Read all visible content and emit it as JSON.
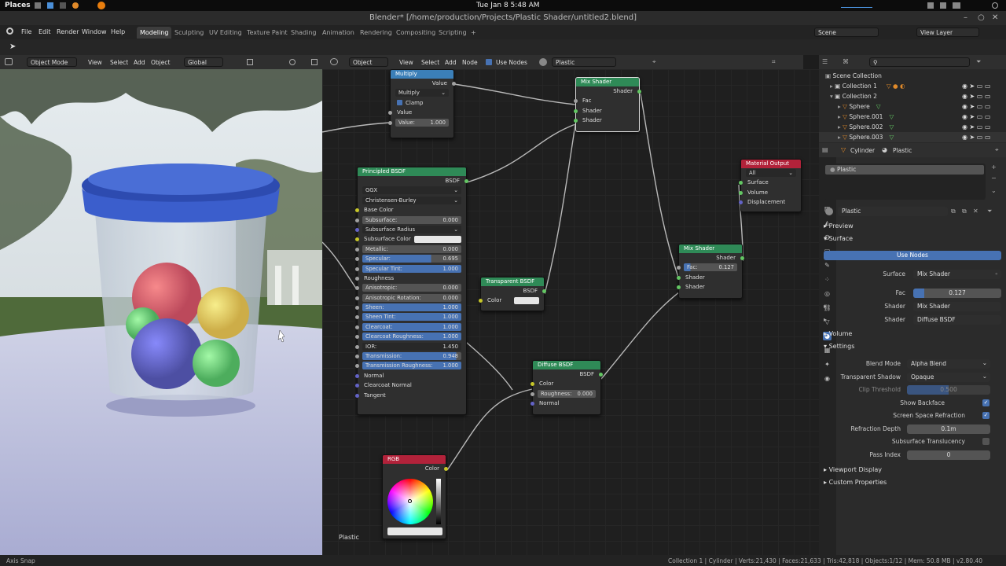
{
  "os_bar": {
    "places": "Places",
    "clock": "Tue Jan 8  5:48 AM"
  },
  "window_title": "Blender* [/home/production/Projects/Plastic Shader/untitled2.blend]",
  "menu": [
    "File",
    "Edit",
    "Render",
    "Window",
    "Help"
  ],
  "workspaces": [
    "Modeling",
    "Sculpting",
    "UV Editing",
    "Texture Paint",
    "Shading",
    "Animation",
    "Rendering",
    "Compositing",
    "Scripting"
  ],
  "active_workspace": "Modeling",
  "scene": "Scene",
  "view_layer": "View Layer",
  "viewport_header": {
    "mode": "Object Mode",
    "items": [
      "View",
      "Select",
      "Add",
      "Object"
    ],
    "transform": "Global"
  },
  "node_header": {
    "type": "Object",
    "items": [
      "View",
      "Select",
      "Add",
      "Node"
    ],
    "use_nodes": "Use Nodes",
    "material": "Plastic"
  },
  "nodes": {
    "multiply": {
      "title": "Multiply",
      "out": "Value",
      "op": "Multiply",
      "clamp": "Clamp",
      "in": "Value",
      "value_label": "Value:",
      "value": "1.000"
    },
    "mix1": {
      "title": "Mix Shader",
      "out": "Shader",
      "in1": "Fac",
      "in2": "Shader",
      "in3": "Shader"
    },
    "principled": {
      "title": "Principled BSDF",
      "out": "BSDF",
      "dist": "GGX",
      "sss_method": "Christensen-Burley",
      "base_color": "Base Color",
      "subsurface": {
        "label": "Subsurface:",
        "value": "0.000"
      },
      "subsurface_radius": "Subsurface Radius",
      "subsurface_color": "Subsurface Color",
      "metallic": {
        "label": "Metallic:",
        "value": "0.000"
      },
      "specular": {
        "label": "Specular:",
        "value": "0.695"
      },
      "specular_tint": {
        "label": "Specular Tint:",
        "value": "1.000"
      },
      "roughness": "Roughness",
      "anisotropic": {
        "label": "Anisotropic:",
        "value": "0.000"
      },
      "aniso_rot": {
        "label": "Anisotropic Rotation:",
        "value": "0.000"
      },
      "sheen": {
        "label": "Sheen:",
        "value": "1.000"
      },
      "sheen_tint": {
        "label": "Sheen Tint:",
        "value": "1.000"
      },
      "clearcoat": {
        "label": "Clearcoat:",
        "value": "1.000"
      },
      "clearcoat_rough": {
        "label": "Clearcoat Roughness:",
        "value": "1.000"
      },
      "ior": {
        "label": "IOR:",
        "value": "1.450"
      },
      "transmission": {
        "label": "Transmission:",
        "value": "0.948"
      },
      "trans_rough": {
        "label": "Transmission Roughness:",
        "value": "1.000"
      },
      "normal": "Normal",
      "clearcoat_normal": "Clearcoat Normal",
      "tangent": "Tangent"
    },
    "transparent": {
      "title": "Transparent BSDF",
      "out": "BSDF",
      "color": "Color"
    },
    "material_output": {
      "title": "Material Output",
      "target": "All",
      "surface": "Surface",
      "volume": "Volume",
      "displacement": "Displacement"
    },
    "mix2": {
      "title": "Mix Shader",
      "out": "Shader",
      "fac_label": "Fac:",
      "fac": "0.127",
      "in2": "Shader",
      "in3": "Shader"
    },
    "diffuse": {
      "title": "Diffuse BSDF",
      "out": "BSDF",
      "color": "Color",
      "rough_label": "Roughness:",
      "rough": "0.000",
      "normal": "Normal"
    },
    "rgb": {
      "title": "RGB",
      "out": "Color"
    }
  },
  "node_editor_label": "Plastic",
  "outliner": {
    "rows": [
      {
        "name": "Scene Collection",
        "depth": 0
      },
      {
        "name": "Collection 1",
        "depth": 1
      },
      {
        "name": "Collection 2",
        "depth": 1
      },
      {
        "name": "Sphere",
        "depth": 2
      },
      {
        "name": "Sphere.001",
        "depth": 2
      },
      {
        "name": "Sphere.002",
        "depth": 2
      },
      {
        "name": "Sphere.003",
        "depth": 2
      }
    ]
  },
  "properties": {
    "object": "Cylinder",
    "material": "Plastic",
    "slot": "Plastic",
    "datablock": "Plastic",
    "preview": "Preview",
    "surface_section": "Surface",
    "use_nodes": "Use Nodes",
    "surface_label": "Surface",
    "surface_value": "Mix Shader",
    "fac_label": "Fac",
    "fac_value": "0.127",
    "fac_fraction": 0.127,
    "shader1_label": "Shader",
    "shader1_value": "Mix Shader",
    "shader2_label": "Shader",
    "shader2_value": "Diffuse BSDF",
    "volume_section": "Volume",
    "settings_section": "Settings",
    "blend_mode_label": "Blend Mode",
    "blend_mode": "Alpha Blend",
    "shadow_label": "Transparent Shadow",
    "shadow": "Opaque",
    "clip_label": "Clip Threshold",
    "clip": "0.500",
    "clip_fraction": 0.5,
    "backface_label": "Show Backface",
    "ssr_label": "Screen Space Refraction",
    "refraction_label": "Refraction Depth",
    "refraction": "0.1m",
    "translucency_label": "Subsurface Translucency",
    "pass_label": "Pass Index",
    "pass": "0",
    "viewport_display": "Viewport Display",
    "custom_props": "Custom Properties"
  },
  "status": {
    "left": "Axis Snap",
    "right": "Collection 1 | Cylinder | Verts:21,430 | Faces:21,633 | Tris:42,818 | Objects:1/12 | Mem: 50.8 MB | v2.80.40"
  },
  "colors": {
    "accent": "#4772b3",
    "shader_header": "#2f8a57",
    "converter_header": "#3b7fb8",
    "output_header": "#b2223a",
    "input_header": "#b2223a",
    "socket_green": "#63c763",
    "socket_gray": "#a1a1a1",
    "socket_yellow": "#c7c729",
    "socket_purple": "#6363c7"
  }
}
